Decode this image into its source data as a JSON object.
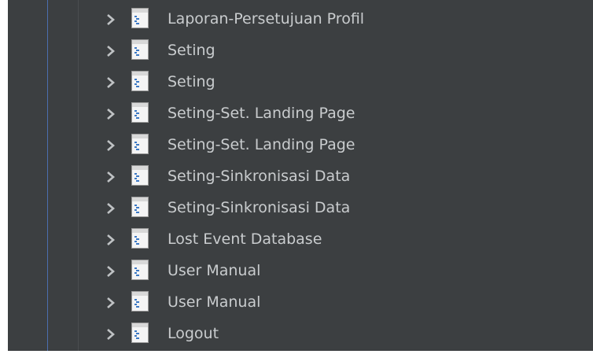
{
  "colors": {
    "background": "#3c3f41",
    "text": "#c9ccce",
    "chevron": "#bfc2c4",
    "guide_active": "#4b6eaf",
    "guide_inactive": "#4a4d50"
  },
  "tree": {
    "items": [
      {
        "label": "Laporan-Persetujuan Profil",
        "expander_icon": "chevron-right-icon",
        "icon": "page-node-icon"
      },
      {
        "label": "Seting",
        "expander_icon": "chevron-right-icon",
        "icon": "page-node-icon"
      },
      {
        "label": "Seting",
        "expander_icon": "chevron-right-icon",
        "icon": "page-node-icon"
      },
      {
        "label": "Seting-Set. Landing Page",
        "expander_icon": "chevron-right-icon",
        "icon": "page-node-icon"
      },
      {
        "label": "Seting-Set. Landing Page",
        "expander_icon": "chevron-right-icon",
        "icon": "page-node-icon"
      },
      {
        "label": "Seting-Sinkronisasi Data",
        "expander_icon": "chevron-right-icon",
        "icon": "page-node-icon"
      },
      {
        "label": "Seting-Sinkronisasi Data",
        "expander_icon": "chevron-right-icon",
        "icon": "page-node-icon"
      },
      {
        "label": "Lost Event Database",
        "expander_icon": "chevron-right-icon",
        "icon": "page-node-icon"
      },
      {
        "label": "User Manual",
        "expander_icon": "chevron-right-icon",
        "icon": "page-node-icon"
      },
      {
        "label": "User Manual",
        "expander_icon": "chevron-right-icon",
        "icon": "page-node-icon"
      },
      {
        "label": "Logout",
        "expander_icon": "chevron-right-icon",
        "icon": "page-node-icon"
      }
    ]
  }
}
